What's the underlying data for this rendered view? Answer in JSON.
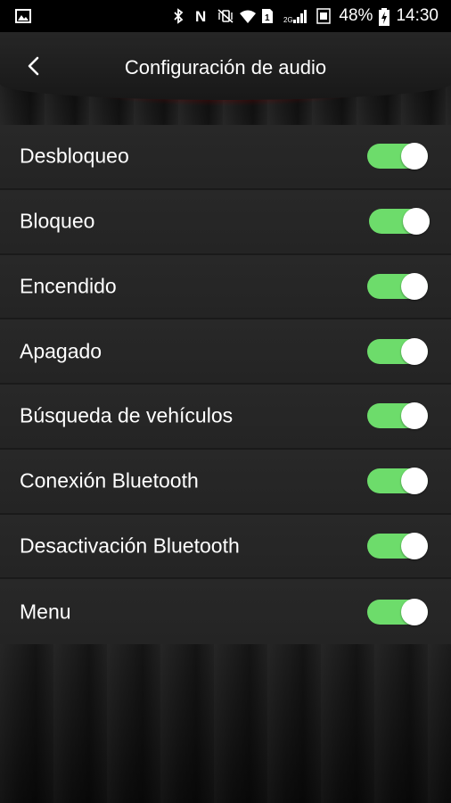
{
  "status_bar": {
    "battery_percent": "48%",
    "time": "14:30",
    "network_label": "2G",
    "icons": [
      "gallery-icon",
      "bluetooth-icon",
      "nfc-icon",
      "vibrate-mute-icon",
      "wifi-icon",
      "sim1-icon",
      "signal-icon",
      "sim2-icon",
      "battery-charging-icon"
    ]
  },
  "header": {
    "title": "Configuración de audio",
    "back_icon": "chevron-left-icon"
  },
  "settings": [
    {
      "label": "Desbloqueo",
      "enabled": true
    },
    {
      "label": "Bloqueo",
      "enabled": true
    },
    {
      "label": "Encendido",
      "enabled": true
    },
    {
      "label": "Apagado",
      "enabled": true
    },
    {
      "label": "Búsqueda de vehículos",
      "enabled": true
    },
    {
      "label": "Conexión Bluetooth",
      "enabled": true
    },
    {
      "label": "Desactivación Bluetooth",
      "enabled": true
    },
    {
      "label": "Menu",
      "enabled": true
    }
  ],
  "colors": {
    "toggle_on": "#6ddc6b",
    "accent_red": "#c80000"
  }
}
